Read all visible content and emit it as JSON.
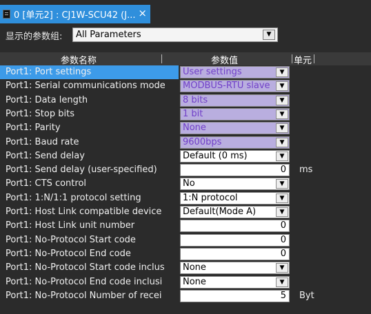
{
  "tab": {
    "title": "0 [单元2] : CJ1W-SCU42 (J...",
    "close": "×"
  },
  "group": {
    "label": "显示的参数组:",
    "value": "All Parameters"
  },
  "headers": {
    "name": "参数名称",
    "value": "参数值",
    "unit": "单元"
  },
  "rows": [
    {
      "name": "Port1: Port settings",
      "value": "User settings",
      "type": "combo",
      "custom": true,
      "unit": ""
    },
    {
      "name": "Port1: Serial communications mode",
      "value": "MODBUS-RTU slave",
      "type": "combo",
      "custom": true,
      "unit": ""
    },
    {
      "name": "Port1: Data length",
      "value": "8 bits",
      "type": "combo",
      "custom": true,
      "unit": ""
    },
    {
      "name": "Port1: Stop bits",
      "value": "1 bit",
      "type": "combo",
      "custom": true,
      "unit": ""
    },
    {
      "name": "Port1: Parity",
      "value": "None",
      "type": "combo",
      "custom": true,
      "unit": ""
    },
    {
      "name": "Port1: Baud rate",
      "value": "9600bps",
      "type": "combo",
      "custom": true,
      "unit": ""
    },
    {
      "name": "Port1: Send delay",
      "value": "Default (0 ms)",
      "type": "combo",
      "custom": false,
      "unit": ""
    },
    {
      "name": "Port1: Send delay (user-specified)",
      "value": "0",
      "type": "num",
      "custom": false,
      "unit": "ms"
    },
    {
      "name": "Port1: CTS control",
      "value": "No",
      "type": "combo",
      "custom": false,
      "unit": ""
    },
    {
      "name": "Port1: 1:N/1:1 protocol setting",
      "value": "1:N protocol",
      "type": "combo",
      "custom": false,
      "unit": ""
    },
    {
      "name": "Port1: Host Link compatible device",
      "value": "Default(Mode A)",
      "type": "combo",
      "custom": false,
      "unit": ""
    },
    {
      "name": "Port1: Host Link unit number",
      "value": "0",
      "type": "num",
      "custom": false,
      "unit": ""
    },
    {
      "name": "Port1: No-Protocol Start code",
      "value": "0",
      "type": "num",
      "custom": false,
      "unit": ""
    },
    {
      "name": "Port1: No-Protocol End code",
      "value": "0",
      "type": "num",
      "custom": false,
      "unit": ""
    },
    {
      "name": "Port1: No-Protocol Start code inclus",
      "value": "None",
      "type": "combo",
      "custom": false,
      "unit": ""
    },
    {
      "name": "Port1: No-Protocol End code inclusi",
      "value": "None",
      "type": "combo",
      "custom": false,
      "unit": ""
    },
    {
      "name": "Port1: No-Protocol Number of recei",
      "value": "5",
      "type": "num",
      "custom": false,
      "unit": "Byt"
    }
  ],
  "icons": {
    "dropdown": "chevron-down-icon",
    "tab": "window-icon",
    "close": "close-icon"
  },
  "colors": {
    "tab_active": "#2f8fdc",
    "selected_row": "#3d9be9",
    "custom_value_bg": "#b9aedf",
    "custom_value_text": "#7140c8",
    "background": "#2b2b2b"
  }
}
